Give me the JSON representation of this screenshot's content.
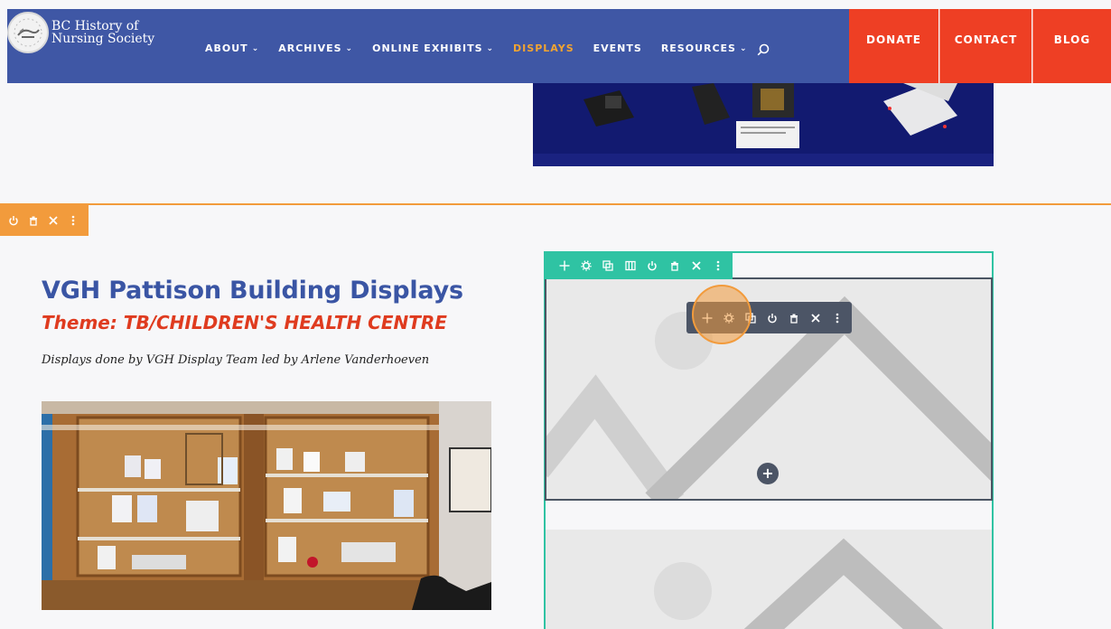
{
  "site": {
    "name_line1": "BC History of",
    "name_line2": "Nursing Society"
  },
  "nav": {
    "items": [
      {
        "label": "ABOUT",
        "has_dropdown": true
      },
      {
        "label": "ARCHIVES",
        "has_dropdown": true
      },
      {
        "label": "ONLINE EXHIBITS",
        "has_dropdown": true
      },
      {
        "label": "DISPLAYS",
        "has_dropdown": false,
        "active": true
      },
      {
        "label": "EVENTS",
        "has_dropdown": false
      },
      {
        "label": "RESOURCES",
        "has_dropdown": true
      }
    ],
    "cta": {
      "donate": "DONATE",
      "contact": "CONTACT",
      "blog": "BLOG"
    }
  },
  "content": {
    "heading": "VGH Pattison Building Displays",
    "theme": "Theme:  TB/CHILDREN'S HEALTH CENTRE",
    "byline": "Displays done by VGH Display Team led by Arlene Vanderhoeven"
  },
  "builder": {
    "add_label": "+"
  },
  "colors": {
    "header_bg": "#3f57a5",
    "cta_bg": "#ee3f24",
    "active_nav": "#f2a431",
    "section_toolbar": "#f29b3c",
    "row_toolbar": "#2fc3a3",
    "module_toolbar": "#4c5566",
    "heading": "#3a55a4",
    "theme": "#df3b1f"
  }
}
